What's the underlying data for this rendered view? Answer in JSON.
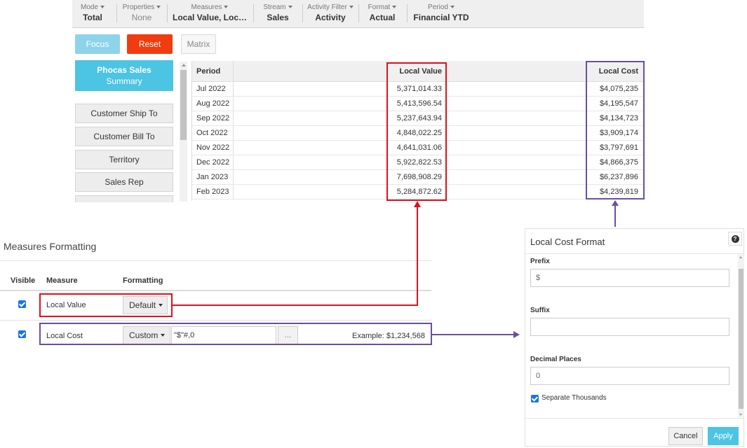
{
  "toolbar": {
    "items": [
      {
        "label": "Mode",
        "value": "Total"
      },
      {
        "label": "Properties",
        "value": "None"
      },
      {
        "label": "Measures",
        "value": "Local Value, Loc…"
      },
      {
        "label": "Stream",
        "value": "Sales"
      },
      {
        "label": "Activity Filter",
        "value": "Activity"
      },
      {
        "label": "Format",
        "value": "Actual"
      },
      {
        "label": "Period",
        "value": "Financial YTD"
      }
    ]
  },
  "actions": {
    "focus": "Focus",
    "reset": "Reset",
    "matrix": "Matrix"
  },
  "dimensions": {
    "main_line1": "Phocas Sales",
    "main_line2": "Summary",
    "items": [
      "Customer Ship To",
      "Customer Bill To",
      "Territory",
      "Sales Rep"
    ]
  },
  "grid": {
    "headers": {
      "period": "Period",
      "local_value": "Local Value",
      "local_cost": "Local Cost"
    },
    "rows": [
      {
        "period": "Jul 2022",
        "local_value": "5,371,014.33",
        "local_cost": "$4,075,235"
      },
      {
        "period": "Aug 2022",
        "local_value": "5,413,596.54",
        "local_cost": "$4,195,547"
      },
      {
        "period": "Sep 2022",
        "local_value": "5,237,643.94",
        "local_cost": "$4,134,723"
      },
      {
        "period": "Oct 2022",
        "local_value": "4,848,022.25",
        "local_cost": "$3,909,174"
      },
      {
        "period": "Nov 2022",
        "local_value": "4,641,031.06",
        "local_cost": "$3,797,691"
      },
      {
        "period": "Dec 2022",
        "local_value": "5,922,822.53",
        "local_cost": "$4,866,375"
      },
      {
        "period": "Jan 2023",
        "local_value": "7,698,908.29",
        "local_cost": "$6,237,896"
      },
      {
        "period": "Feb 2023",
        "local_value": "5,284,872.62",
        "local_cost": "$4,239,819"
      }
    ]
  },
  "measures_formatting": {
    "title": "Measures Formatting",
    "headers": {
      "visible": "Visible",
      "measure": "Measure",
      "formatting": "Formatting"
    },
    "rows": [
      {
        "measure": "Local Value",
        "format": "Default",
        "visible": true
      },
      {
        "measure": "Local Cost",
        "format": "Custom",
        "format_string": "\"$\"#,0",
        "ellipsis": "...",
        "example": "Example: $1,234,568",
        "visible": true
      }
    ]
  },
  "dialog": {
    "title": "Local Cost Format",
    "help": "?",
    "prefix_label": "Prefix",
    "prefix_value": "$",
    "suffix_label": "Suffix",
    "suffix_value": "",
    "decimal_label": "Decimal Places",
    "decimal_value": "0",
    "separate_thousands_label": "Separate Thousands",
    "separate_thousands": true,
    "cancel": "Cancel",
    "apply": "Apply"
  },
  "colors": {
    "accent": "#4cc4e4",
    "reset": "#f13c0f",
    "highlight_red": "#e0101c",
    "highlight_purple": "#6a4fa0"
  }
}
